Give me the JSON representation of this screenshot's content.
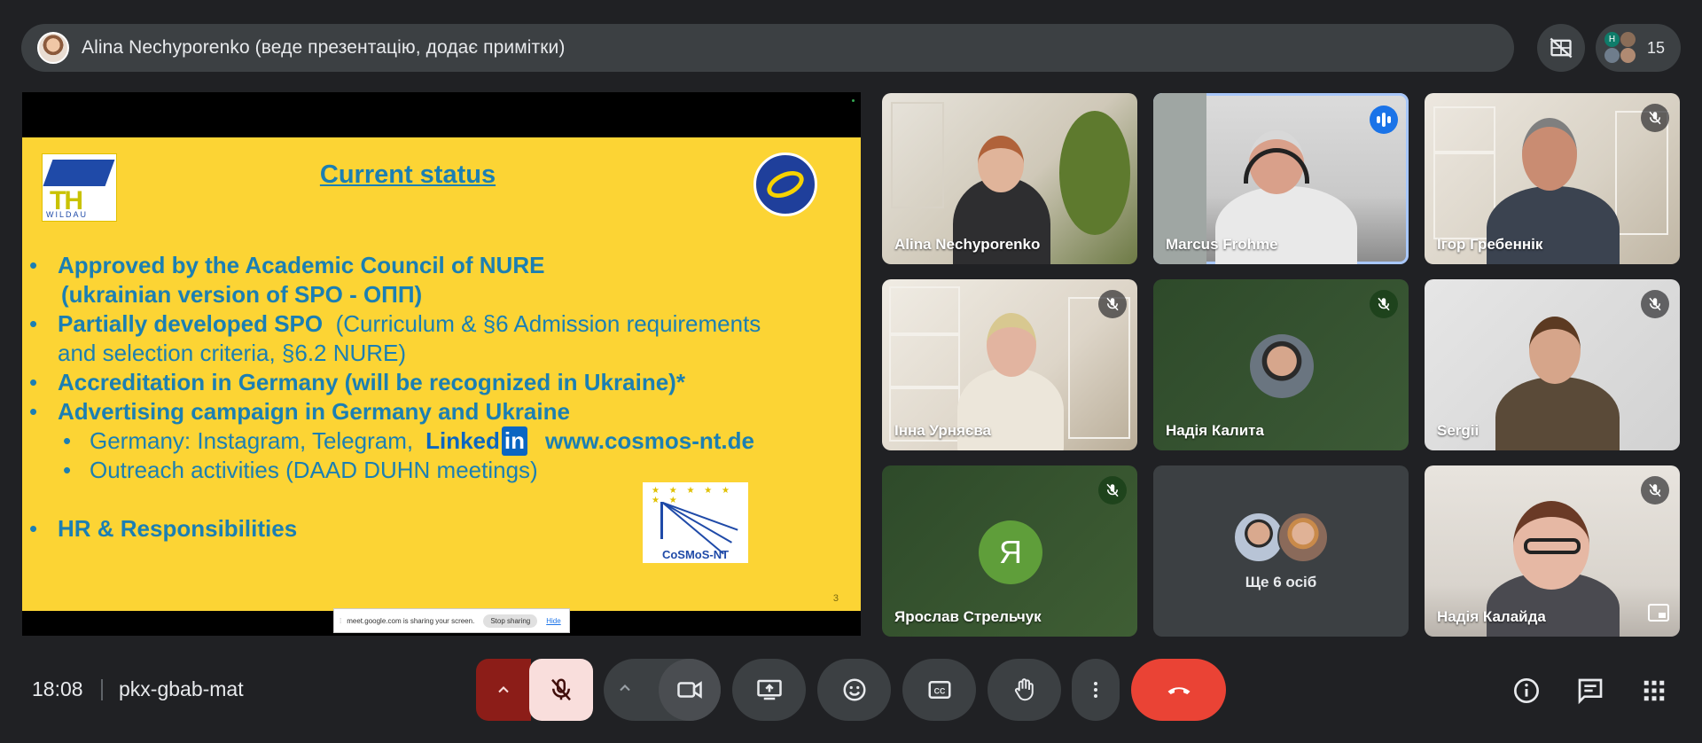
{
  "presenter_bar": {
    "text": "Alina Nechyporenko (веде презентацію, додає примітки)"
  },
  "participants_count": "15",
  "mini_avatar_initial": "H",
  "slide": {
    "title": "Current status",
    "logo_left_letters": "TH",
    "logo_left_word": "WILDAU",
    "bullets": [
      {
        "bold": "Approved by the Academic Council of NURE",
        "rest": ""
      },
      {
        "bold": "(ukrainian version of SPO - ОПП)",
        "rest": ""
      },
      {
        "bold": "Partially developed SPO",
        "rest": "  (Curriculum & §6 Admission requirements"
      },
      {
        "bold": "",
        "rest": "and selection criteria, §6.2 NURE)"
      },
      {
        "bold": "Accreditation in Germany (will be recognized in Ukraine)*",
        "rest": ""
      },
      {
        "bold": "Advertising campaign in Germany and Ukraine",
        "rest": ""
      }
    ],
    "sub_bullet_1": "Germany: Instagram, Telegram,",
    "linkedin_text": "Linked",
    "linkedin_in": "in",
    "website": "www.cosmos-nt.de",
    "sub_bullet_2": "Outreach activities (DAAD DUHN meetings)",
    "last_bullet": "HR & Responsibilities",
    "cosmos_logo": "CoSMoS-NT",
    "slide_number": "3",
    "share_notice": "meet.google.com is sharing your screen.",
    "stop_sharing": "Stop sharing",
    "hide": "Hide"
  },
  "tiles": [
    {
      "name": "Alina Nechyporenko"
    },
    {
      "name": "Marcus Frohme"
    },
    {
      "name": "Ігор Гребеннік"
    },
    {
      "name": "Інна Урняєва"
    },
    {
      "name": "Надія Калита"
    },
    {
      "name": "Sergii"
    },
    {
      "name": "Ярослав Стрельчук",
      "initial": "Я"
    },
    {
      "name": "Ще 6 осіб"
    },
    {
      "name": "Надія Калайда"
    }
  ],
  "bottom": {
    "time": "18:08",
    "meeting_code": "pkx-gbab-mat"
  },
  "colors": {
    "end_call": "#ea4335",
    "mic_off_bg": "#f9dedc",
    "mic_toggle_bg": "#8c1d18",
    "accent": "#a8c7fa"
  }
}
